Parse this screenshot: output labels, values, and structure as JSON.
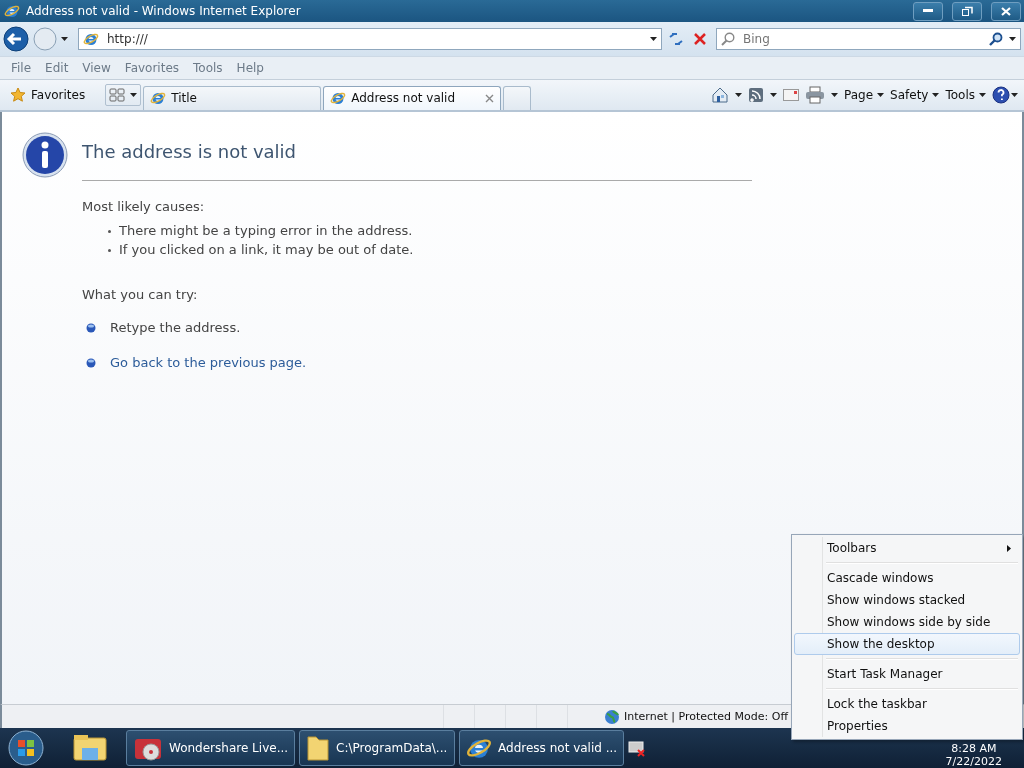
{
  "window": {
    "title": "Address not valid - Windows Internet Explorer"
  },
  "address_bar": {
    "value": "http:///"
  },
  "search": {
    "placeholder": "Bing"
  },
  "menu_bar": [
    "File",
    "Edit",
    "View",
    "Favorites",
    "Tools",
    "Help"
  ],
  "favorites_button": "Favorites",
  "tabs": [
    {
      "label": "Title",
      "selected": false
    },
    {
      "label": "Address not valid",
      "selected": true
    }
  ],
  "command_bar": [
    "Page",
    "Safety",
    "Tools"
  ],
  "page": {
    "heading": "The address is not valid",
    "causes_heading": "Most likely causes:",
    "causes": [
      "There might be a typing error in the address.",
      "If you clicked on a link, it may be out of date."
    ],
    "try_heading": "What you can try:",
    "actions": [
      {
        "text": "Retype the address.",
        "kind": "text"
      },
      {
        "text": "Go back to the previous page.",
        "kind": "link"
      }
    ]
  },
  "status_bar": {
    "zone": "Internet | Protected Mode: Off"
  },
  "taskbar": {
    "buttons": [
      {
        "label": "Wondershare Live...",
        "kind": "toolbox"
      },
      {
        "label": "C:\\ProgramData\\...",
        "kind": "folder"
      },
      {
        "label": "Address not valid ...",
        "kind": "browser"
      }
    ],
    "clock": {
      "time": "8:28 AM",
      "date": "7/22/2022"
    }
  },
  "context_menu": {
    "groups": [
      [
        {
          "label": "Toolbars",
          "submenu": true,
          "selected": false
        }
      ],
      [
        {
          "label": "Cascade windows",
          "submenu": false,
          "selected": false
        },
        {
          "label": "Show windows stacked",
          "submenu": false,
          "selected": false
        },
        {
          "label": "Show windows side by side",
          "submenu": false,
          "selected": false
        },
        {
          "label": "Show the desktop",
          "submenu": false,
          "selected": true
        }
      ],
      [
        {
          "label": "Start Task Manager",
          "submenu": false,
          "selected": false
        }
      ],
      [
        {
          "label": "Lock the taskbar",
          "submenu": false,
          "selected": false
        },
        {
          "label": "Properties",
          "submenu": false,
          "selected": false
        }
      ]
    ]
  }
}
